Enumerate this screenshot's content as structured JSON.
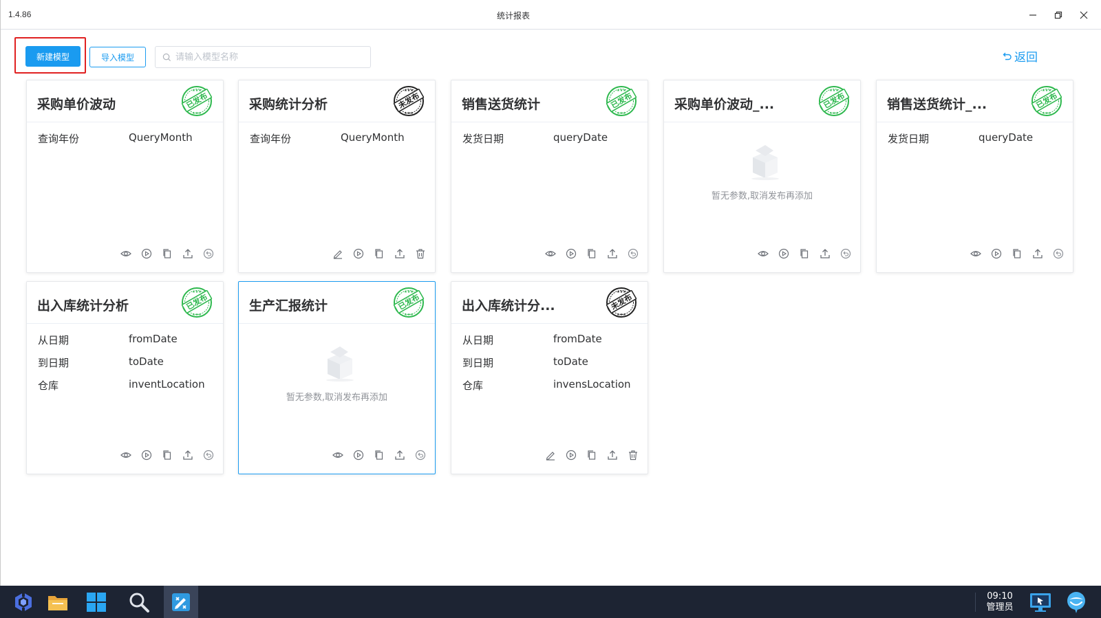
{
  "window": {
    "version": "1.4.86",
    "title": "统计报表"
  },
  "toolbar": {
    "new_model_label": "新建模型",
    "import_model_label": "导入模型",
    "search_placeholder": "请输入模型名称",
    "back_label": "返回"
  },
  "status_labels": {
    "published": "已发布",
    "unpublished": "未发布"
  },
  "colors": {
    "accent": "#1a9bf0",
    "published_stamp": "#2db84d",
    "unpublished_stamp": "#222222",
    "highlight": "#e02020"
  },
  "empty_text": "暂无参数,取消发布再添加",
  "cards": [
    {
      "title": "采购单价波动",
      "status": "published",
      "params": [
        {
          "label": "查询年份",
          "value": "QueryMonth"
        }
      ]
    },
    {
      "title": "采购统计分析",
      "status": "unpublished",
      "params": [
        {
          "label": "查询年份",
          "value": "QueryMonth"
        }
      ]
    },
    {
      "title": "销售送货统计",
      "status": "published",
      "params": [
        {
          "label": "发货日期",
          "value": "queryDate"
        }
      ]
    },
    {
      "title": "采购单价波动_...",
      "status": "published",
      "params": []
    },
    {
      "title": "销售送货统计_...",
      "status": "published",
      "params": [
        {
          "label": "发货日期",
          "value": "queryDate"
        }
      ]
    },
    {
      "title": "出入库统计分析",
      "status": "published",
      "params": [
        {
          "label": "从日期",
          "value": "fromDate"
        },
        {
          "label": "到日期",
          "value": "toDate"
        },
        {
          "label": "仓库",
          "value": "inventLocation"
        }
      ]
    },
    {
      "title": "生产汇报统计",
      "status": "published",
      "params": []
    },
    {
      "title": "出入库统计分...",
      "status": "unpublished",
      "params": [
        {
          "label": "从日期",
          "value": "fromDate"
        },
        {
          "label": "到日期",
          "value": "toDate"
        },
        {
          "label": "仓库",
          "value": "invensLocation"
        }
      ]
    }
  ],
  "taskbar": {
    "time": "09:10",
    "user": "管理员"
  }
}
